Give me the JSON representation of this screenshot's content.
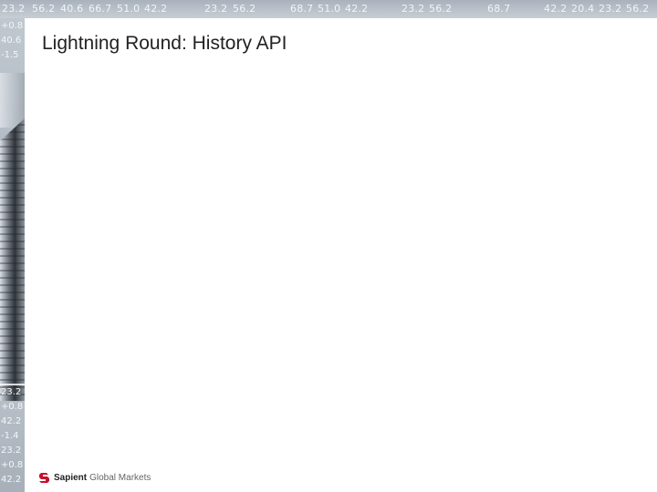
{
  "slide": {
    "title": "Lightning Round: History API"
  },
  "ticker": {
    "top_values": [
      "23.2",
      "56.2",
      "40.6",
      "66.7",
      "51.0",
      "42.2",
      "23.2",
      "56.2",
      "68.7",
      "51.0",
      "42.2",
      "23.2",
      "56.2",
      "68.7",
      "42.2",
      "20.4",
      "23.2",
      "56.2"
    ],
    "left_upper_values": [
      "+0.8",
      "40.6",
      "-1.5"
    ],
    "left_lower_values": [
      "23.2",
      "+0.8",
      "42.2",
      "-1.4",
      "23.2",
      "+0.8",
      "42.2"
    ]
  },
  "logo": {
    "brand": "Sapient",
    "sub": "Global Markets"
  },
  "colors": {
    "ticker_bg": "#b5bec7",
    "title_text": "#222222",
    "logo_mark": "#c8102e"
  }
}
